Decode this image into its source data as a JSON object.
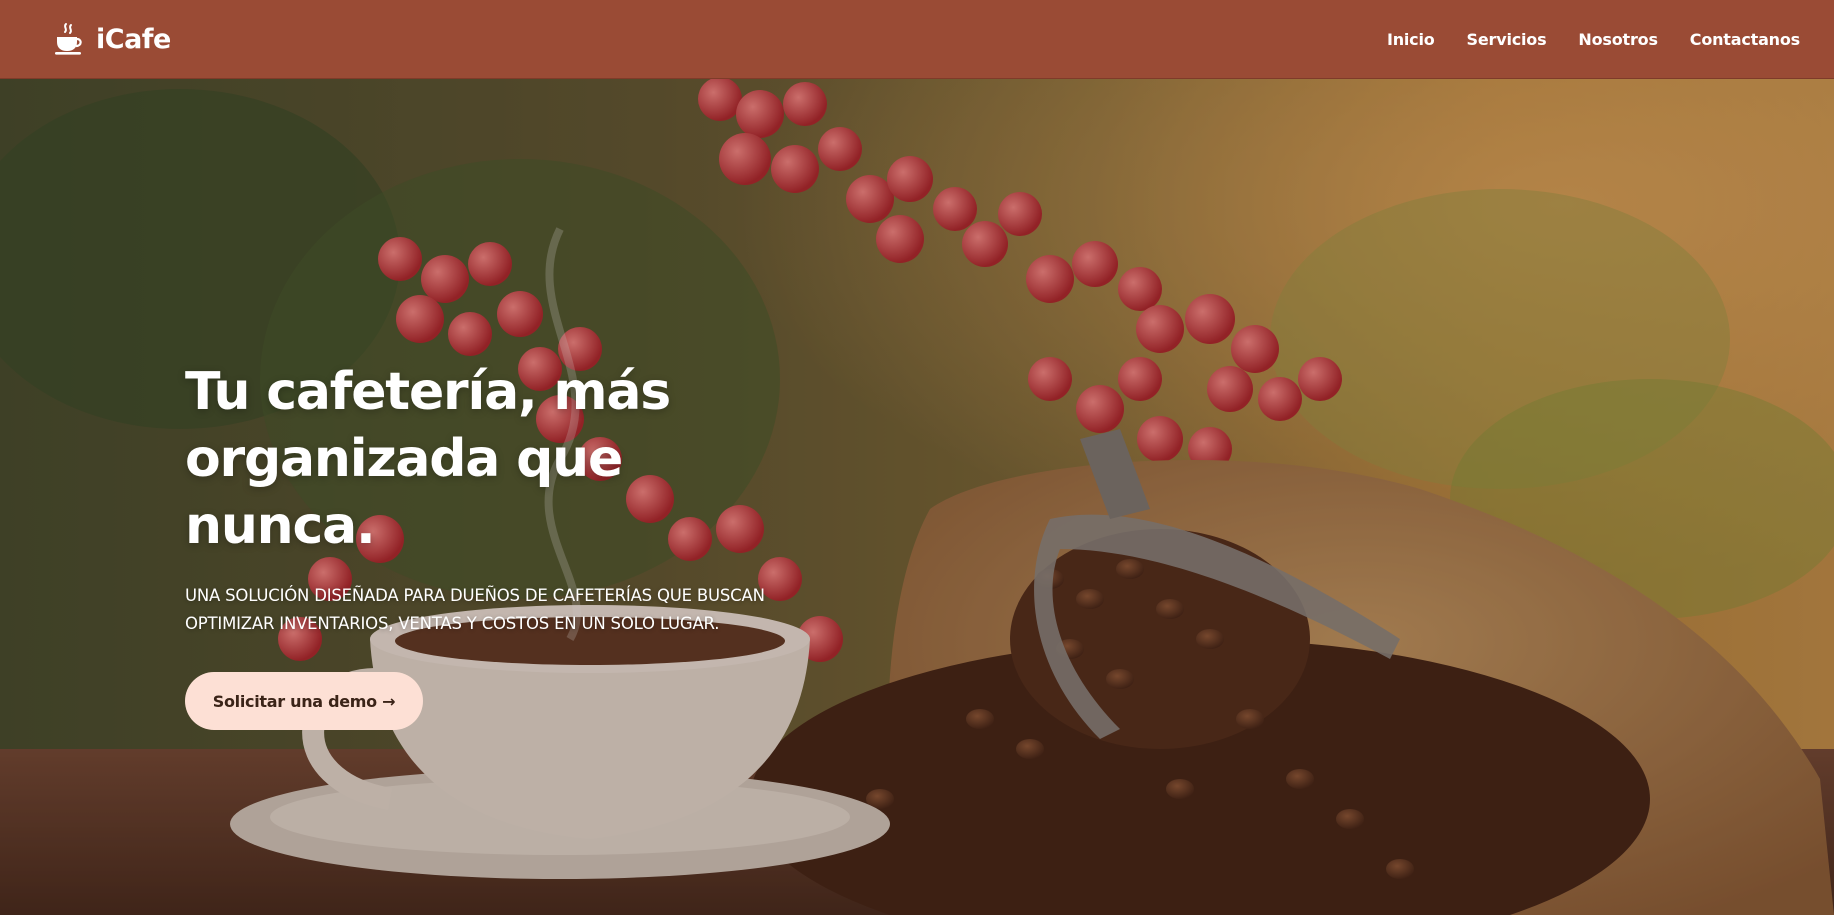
{
  "brand": {
    "name": "iCafe",
    "icon": "coffee-cup-icon"
  },
  "nav": {
    "items": [
      {
        "label": "Inicio"
      },
      {
        "label": "Servicios"
      },
      {
        "label": "Nosotros"
      },
      {
        "label": "Contactanos"
      }
    ]
  },
  "hero": {
    "title": "Tu cafetería, más organizada que nunca.",
    "subtitle": "UNA SOLUCIÓN DISEÑADA PARA DUEÑOS DE CAFETERÍAS QUE BUSCAN OPTIMIZAR INVENTARIOS, VENTAS Y COSTOS EN UN SOLO LUGAR.",
    "cta_label": "Solicitar una demo →"
  },
  "colors": {
    "navbar": "#9a4b35",
    "cta_background": "#fde0d5",
    "cta_text": "#3b2418",
    "text": "#ffffff"
  }
}
